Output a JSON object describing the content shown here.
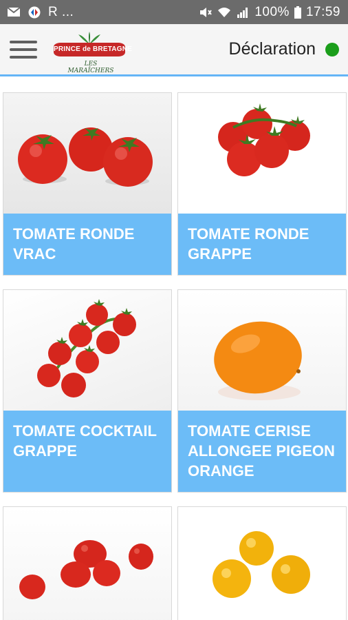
{
  "status_bar": {
    "carrier_text": "R ...",
    "battery": "100%",
    "time": "17:59"
  },
  "app_bar": {
    "logo_text": "PRINCE de BRETAGNE",
    "logo_subtext": "LES MARAÎCHERS",
    "title": "Déclaration",
    "status_color": "#1b9e1b"
  },
  "products": [
    {
      "label": "TOMATE RONDE VRAC",
      "image": "tomato-round-loose"
    },
    {
      "label": "TOMATE RONDE GRAPPE",
      "image": "tomato-round-vine"
    },
    {
      "label": "TOMATE COCKTAIL GRAPPE",
      "image": "tomato-cocktail-vine"
    },
    {
      "label": "TOMATE CERISE ALLONGEE PIGEON ORANGE",
      "image": "tomato-cherry-orange"
    },
    {
      "label": "",
      "image": "tomato-cherry-red"
    },
    {
      "label": "",
      "image": "tomato-cherry-yellow"
    }
  ],
  "colors": {
    "label_background": "#6cbcf7",
    "accent": "#64b5f6"
  }
}
